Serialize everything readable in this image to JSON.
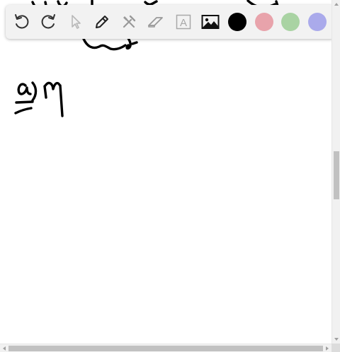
{
  "toolbar": {
    "tools": [
      {
        "name": "undo-icon"
      },
      {
        "name": "redo-icon"
      },
      {
        "name": "select-arrow-icon"
      },
      {
        "name": "pencil-icon"
      },
      {
        "name": "tools-icon"
      },
      {
        "name": "eraser-icon"
      },
      {
        "name": "text-icon",
        "glyph": "A"
      },
      {
        "name": "image-icon"
      }
    ],
    "colors": [
      "#000000",
      "#e8a3ab",
      "#a9d3a3",
      "#aaaaeb"
    ]
  },
  "handwriting": {
    "part_label": "a)",
    "answer": "Mf"
  }
}
